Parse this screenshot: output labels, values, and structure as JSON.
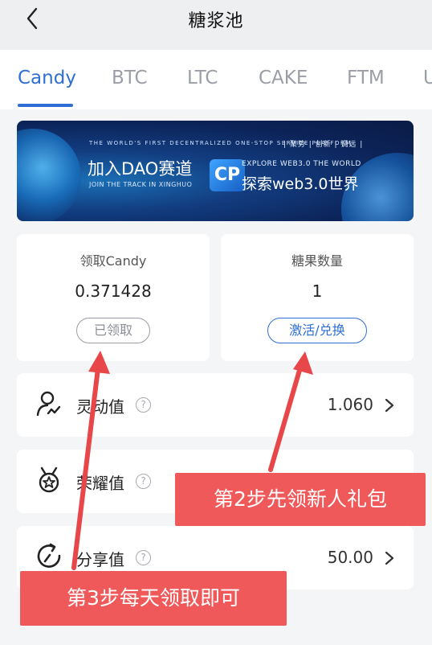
{
  "header": {
    "title": "糖浆池"
  },
  "tabs": [
    {
      "label": "Candy",
      "active": true
    },
    {
      "label": "BTC"
    },
    {
      "label": "LTC"
    },
    {
      "label": "CAKE"
    },
    {
      "label": "FTM"
    },
    {
      "label": "U"
    }
  ],
  "banner": {
    "tagline": "THE WORLD'S FIRST DECENTRALIZED ONE-STOP SERVICE PLATFORM",
    "tagline2": "| 聚势 | 创新 | 调远 |",
    "join_cn": "加入DAO赛道",
    "join_en": "JOIN THE TRACK IN XINGHUO",
    "logo": "CP",
    "explore_en": "EXPLORE WEB3.0 THE WORLD",
    "explore_cn": "探索web3.0世界"
  },
  "cards": {
    "claim": {
      "label": "领取Candy",
      "value": "0.371428",
      "button": "已领取"
    },
    "candy_count": {
      "label": "糖果数量",
      "value": "1",
      "button": "激活/兑换"
    }
  },
  "rows": [
    {
      "label": "灵动值",
      "value": "1.060",
      "icon": "person-wave-icon"
    },
    {
      "label": "荣耀值",
      "value": "",
      "icon": "medal-icon"
    },
    {
      "label": "分享值",
      "value": "50.00",
      "icon": "refresh-icon"
    }
  ],
  "callouts": {
    "step2": "第2步先领新人礼包",
    "step3": "第3步每天领取即可"
  },
  "colors": {
    "accent": "#2f6fd3",
    "callout": "#f0595a",
    "arrow": "#e8474a"
  }
}
